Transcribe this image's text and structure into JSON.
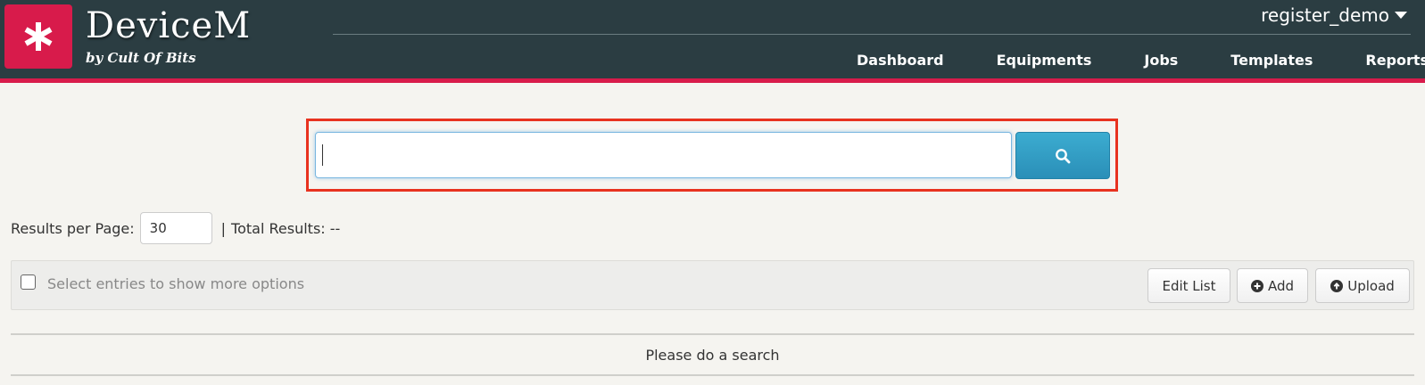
{
  "header": {
    "brand": "DeviceM",
    "tagline": "by Cult Of Bits",
    "user": "register_demo",
    "nav": {
      "dashboard": "Dashboard",
      "equipments": "Equipments",
      "jobs": "Jobs",
      "templates": "Templates",
      "reports": "Reports"
    },
    "colors": {
      "bar": "#2b3d42",
      "accent": "#d81b4b"
    }
  },
  "search": {
    "value": "",
    "button_icon": "search-icon",
    "button_color": "#2a9cc6"
  },
  "results": {
    "per_page_label": "Results per Page:",
    "per_page_value": "30",
    "separator": "|",
    "total_label": "Total Results: --"
  },
  "toolbar": {
    "hint": "Select entries to show more options",
    "edit_label": "Edit List",
    "add_label": "Add",
    "upload_label": "Upload"
  },
  "message": "Please do a search"
}
